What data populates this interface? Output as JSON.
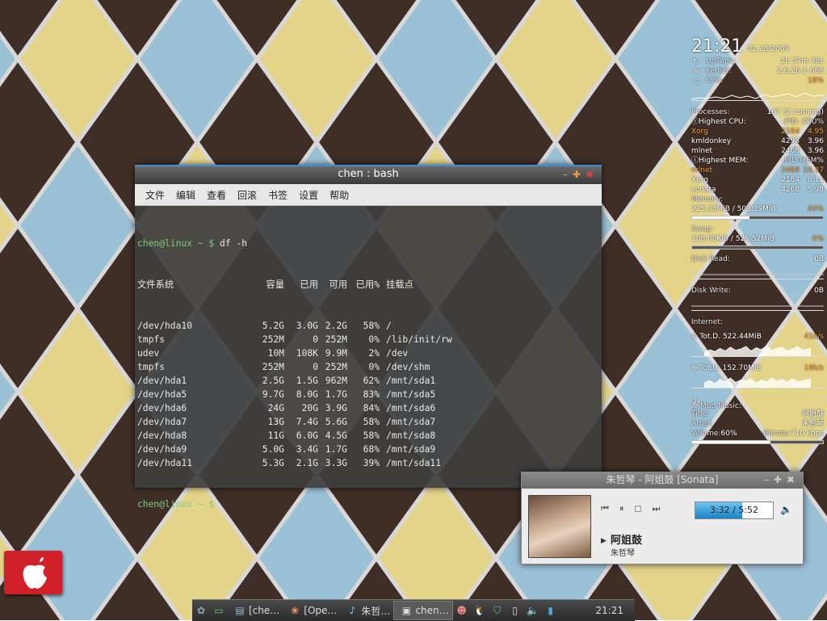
{
  "conky": {
    "time": "21:21",
    "date": "02.28/2009",
    "stats": [
      {
        "label": "UpTime:",
        "value": "2h 57m 38s"
      },
      {
        "label": "Kernel:",
        "value": "2.6.26-1-686"
      },
      {
        "label": "CPU:",
        "value": "18%"
      }
    ],
    "processes_label": "Processes:",
    "processes_value": "167  (2 running)",
    "highest_cpu": {
      "label": "Highest CPU:",
      "pid_hdr": "-PID-",
      "val_hdr": "CPU%",
      "rows": [
        {
          "name": "Xorg",
          "pid": "2184",
          "val": "4.95"
        },
        {
          "name": "kmldonkey",
          "pid": "4298",
          "val": "3.96"
        },
        {
          "name": "mlnet",
          "pid": "2468",
          "val": "3.96"
        }
      ]
    },
    "highest_mem": {
      "label": "Highest MEM:",
      "pid_hdr": "-PID-",
      "val_hdr": "MEM%",
      "rows": [
        {
          "name": "mlnet",
          "pid": "2468",
          "val": "10.37"
        },
        {
          "name": "Xorg",
          "pid": "2184",
          "val": "8.11"
        },
        {
          "name": "sonata",
          "pid": "4268",
          "val": "5.98"
        }
      ]
    },
    "memory_label": "Memory:",
    "memory_value": "225.33MiB / 503.39MiB",
    "memory_pct": "44%",
    "memory_fraction": 0.44,
    "swap_label": "Swap:",
    "swap_value": "108.00KiB / 525.52MiB",
    "swap_pct": "0%",
    "swap_fraction": 0.0,
    "disk_read_label": "Disk Read:",
    "disk_read_value": "0B",
    "disk_write_label": "Disk Write:",
    "disk_write_value": "0B",
    "internet_label": "Internet:",
    "tot_down_label": "Tot.D. 522.44MiB",
    "down_speed": "41k/s",
    "tot_up_label": "Tot.U. 152.70MiB",
    "up_speed": "18k/s",
    "mpd_label": "Mpd Music:",
    "mpd_song": "阿姐鼓",
    "title_label": "Title:",
    "title_value": "朱哲琴",
    "artist_label": "Artist:",
    "volume_label": "Volume:",
    "volume_value": "60%",
    "bitrate_label": "Bitrate:",
    "bitrate_value": "710 kbps",
    "volume_fraction": 0.6,
    "colors": {
      "accent": "#f2a33a"
    }
  },
  "terminal": {
    "title": "chen : bash",
    "menu": [
      "文件",
      "编辑",
      "查看",
      "回滚",
      "书签",
      "设置",
      "帮助"
    ],
    "prompt": "chen@linux ~ $",
    "command": "df -h",
    "header": {
      "fs": "文件系统",
      "size": "容量",
      "used": "已用",
      "avail": "可用",
      "pct": "已用%",
      "mount": "挂载点"
    },
    "rows": [
      {
        "fs": "/dev/hda10",
        "size": "5.2G",
        "used": "3.0G",
        "avail": "2.2G",
        "pct": "58%",
        "mount": "/"
      },
      {
        "fs": "tmpfs",
        "size": "252M",
        "used": "0",
        "avail": "252M",
        "pct": "0%",
        "mount": "/lib/init/rw"
      },
      {
        "fs": "udev",
        "size": "10M",
        "used": "108K",
        "avail": "9.9M",
        "pct": "2%",
        "mount": "/dev"
      },
      {
        "fs": "tmpfs",
        "size": "252M",
        "used": "0",
        "avail": "252M",
        "pct": "0%",
        "mount": "/dev/shm"
      },
      {
        "fs": "/dev/hda1",
        "size": "2.5G",
        "used": "1.5G",
        "avail": "962M",
        "pct": "62%",
        "mount": "/mnt/sda1"
      },
      {
        "fs": "/dev/hda5",
        "size": "9.7G",
        "used": "8.0G",
        "avail": "1.7G",
        "pct": "83%",
        "mount": "/mnt/sda5"
      },
      {
        "fs": "/dev/hda6",
        "size": "24G",
        "used": "20G",
        "avail": "3.9G",
        "pct": "84%",
        "mount": "/mnt/sda6"
      },
      {
        "fs": "/dev/hda7",
        "size": "13G",
        "used": "7.4G",
        "avail": "5.6G",
        "pct": "58%",
        "mount": "/mnt/sda7"
      },
      {
        "fs": "/dev/hda8",
        "size": "11G",
        "used": "6.0G",
        "avail": "4.5G",
        "pct": "58%",
        "mount": "/mnt/sda8"
      },
      {
        "fs": "/dev/hda9",
        "size": "5.0G",
        "used": "3.4G",
        "avail": "1.7G",
        "pct": "68%",
        "mount": "/mnt/sda9"
      },
      {
        "fs": "/dev/hda11",
        "size": "5.3G",
        "used": "2.1G",
        "avail": "3.3G",
        "pct": "39%",
        "mount": "/mnt/sda11"
      }
    ]
  },
  "sonata": {
    "title": "朱哲琴 - 阿姐鼓 [Sonata]",
    "time": "3:32 / 5:52",
    "progress_fraction": 0.6,
    "song": "阿姐鼓",
    "artist": "朱哲琴"
  },
  "taskbar": {
    "tasks": [
      {
        "label": "[che…",
        "icon": "folder-icon"
      },
      {
        "label": "[Ope…",
        "icon": "openoffice-icon"
      },
      {
        "label": "朱哲…",
        "icon": "music-note-icon"
      },
      {
        "label": "chen…",
        "icon": "terminal-icon",
        "active": true
      }
    ],
    "clock": "21:21"
  }
}
